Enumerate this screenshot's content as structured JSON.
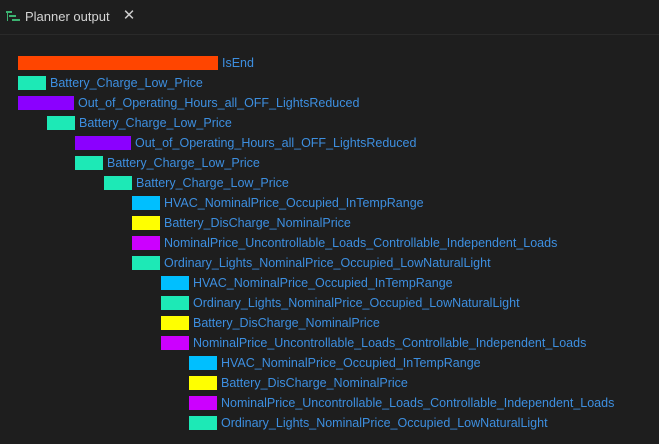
{
  "tab": {
    "title": "Planner output",
    "close_label": "✕",
    "icon": "planner-tree-icon"
  },
  "colors": {
    "is_end": "#ff4500",
    "battery_charge": "#1de9b6",
    "out_of_hours": "#8b00ff",
    "hvac": "#00bfff",
    "battery_discharge": "#ffff00",
    "uncontrollable": "#cc00ff",
    "ordinary_lights": "#1de9b6",
    "label": "#3d8fe0"
  },
  "plan": [
    {
      "label": "IsEnd",
      "depth": 0,
      "color_key": "is_end",
      "wide": true
    },
    {
      "label": "Battery_Charge_Low_Price",
      "depth": 0,
      "color_key": "battery_charge"
    },
    {
      "label": "Out_of_Operating_Hours_all_OFF_LightsReduced",
      "depth": 0,
      "color_key": "out_of_hours",
      "wide2": true
    },
    {
      "label": "Battery_Charge_Low_Price",
      "depth": 1,
      "color_key": "battery_charge"
    },
    {
      "label": "Out_of_Operating_Hours_all_OFF_LightsReduced",
      "depth": 2,
      "color_key": "out_of_hours",
      "wide2": true
    },
    {
      "label": "Battery_Charge_Low_Price",
      "depth": 2,
      "color_key": "battery_charge"
    },
    {
      "label": "Battery_Charge_Low_Price",
      "depth": 3,
      "color_key": "battery_charge"
    },
    {
      "label": "HVAC_NominalPrice_Occupied_InTempRange",
      "depth": 4,
      "color_key": "hvac"
    },
    {
      "label": "Battery_DisCharge_NominalPrice",
      "depth": 4,
      "color_key": "battery_discharge"
    },
    {
      "label": "NominalPrice_Uncontrollable_Loads_Controllable_Independent_Loads",
      "depth": 4,
      "color_key": "uncontrollable"
    },
    {
      "label": "Ordinary_Lights_NominalPrice_Occupied_LowNaturalLight",
      "depth": 4,
      "color_key": "ordinary_lights"
    },
    {
      "label": "HVAC_NominalPrice_Occupied_InTempRange",
      "depth": 5,
      "color_key": "hvac"
    },
    {
      "label": "Ordinary_Lights_NominalPrice_Occupied_LowNaturalLight",
      "depth": 5,
      "color_key": "ordinary_lights"
    },
    {
      "label": "Battery_DisCharge_NominalPrice",
      "depth": 5,
      "color_key": "battery_discharge"
    },
    {
      "label": "NominalPrice_Uncontrollable_Loads_Controllable_Independent_Loads",
      "depth": 5,
      "color_key": "uncontrollable"
    },
    {
      "label": "HVAC_NominalPrice_Occupied_InTempRange",
      "depth": 6,
      "color_key": "hvac"
    },
    {
      "label": "Battery_DisCharge_NominalPrice",
      "depth": 6,
      "color_key": "battery_discharge"
    },
    {
      "label": "NominalPrice_Uncontrollable_Loads_Controllable_Independent_Loads",
      "depth": 6,
      "color_key": "uncontrollable"
    },
    {
      "label": "Ordinary_Lights_NominalPrice_Occupied_LowNaturalLight",
      "depth": 6,
      "color_key": "ordinary_lights"
    }
  ]
}
